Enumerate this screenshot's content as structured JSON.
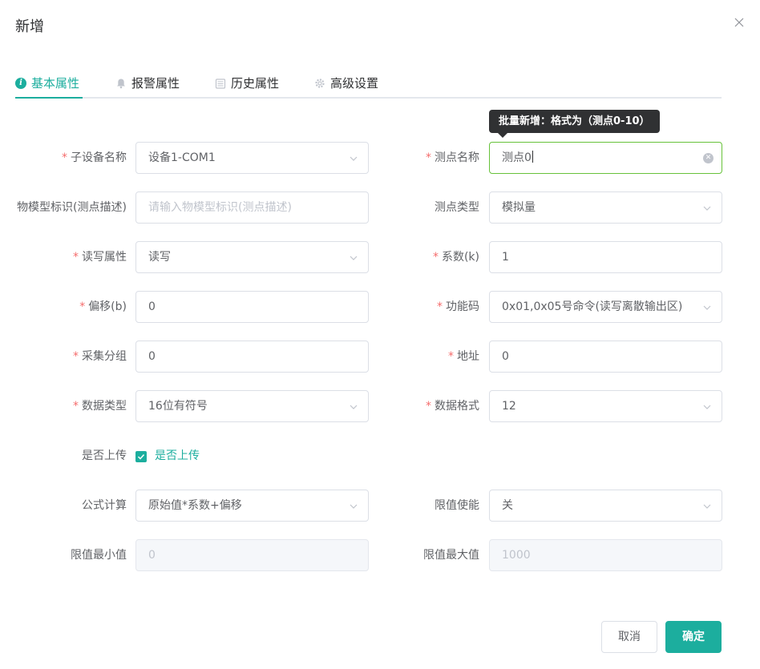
{
  "dialog": {
    "title": "新增"
  },
  "tabs": [
    {
      "label": "基本属性",
      "icon": "info-icon",
      "active": true
    },
    {
      "label": "报警属性",
      "icon": "bell-icon",
      "active": false
    },
    {
      "label": "历史属性",
      "icon": "calendar-icon",
      "active": false
    },
    {
      "label": "高级设置",
      "icon": "gear-icon",
      "active": false
    }
  ],
  "tooltip": {
    "text": "批量新增：格式为（测点0-10）"
  },
  "fields": {
    "sub_device_name": {
      "label": "子设备名称",
      "value": "设备1-COM1",
      "required": true
    },
    "point_name": {
      "label": "测点名称",
      "value": "测点0",
      "required": true
    },
    "model_identifier": {
      "label": "物模型标识(测点描述)",
      "placeholder": "请输入物模型标识(测点描述)",
      "required": false
    },
    "point_type": {
      "label": "测点类型",
      "value": "模拟量",
      "required": false
    },
    "rw_attr": {
      "label": "读写属性",
      "value": "读写",
      "required": true
    },
    "coefficient": {
      "label": "系数(k)",
      "value": "1",
      "required": true
    },
    "offset": {
      "label": "偏移(b)",
      "value": "0",
      "required": true
    },
    "function_code": {
      "label": "功能码",
      "value": "0x01,0x05号命令(读写离散输出区)",
      "required": true
    },
    "collect_group": {
      "label": "采集分组",
      "value": "0",
      "required": true
    },
    "address": {
      "label": "地址",
      "value": "0",
      "required": true
    },
    "data_type": {
      "label": "数据类型",
      "value": "16位有符号",
      "required": true
    },
    "data_format": {
      "label": "数据格式",
      "value": "12",
      "required": true
    },
    "upload": {
      "label": "是否上传",
      "checkbox_label": "是否上传",
      "checked": true
    },
    "formula": {
      "label": "公式计算",
      "value": "原始值*系数+偏移",
      "required": false
    },
    "limit_enable": {
      "label": "限值使能",
      "value": "关",
      "required": false
    },
    "limit_min": {
      "label": "限值最小值",
      "value": "0",
      "required": false
    },
    "limit_max": {
      "label": "限值最大值",
      "value": "1000",
      "required": false
    }
  },
  "buttons": {
    "cancel": "取消",
    "ok": "确定"
  },
  "colors": {
    "accent": "#1cae9e",
    "required": "#f56c6c",
    "focus": "#67c23a",
    "tooltip_bg": "#303133"
  }
}
